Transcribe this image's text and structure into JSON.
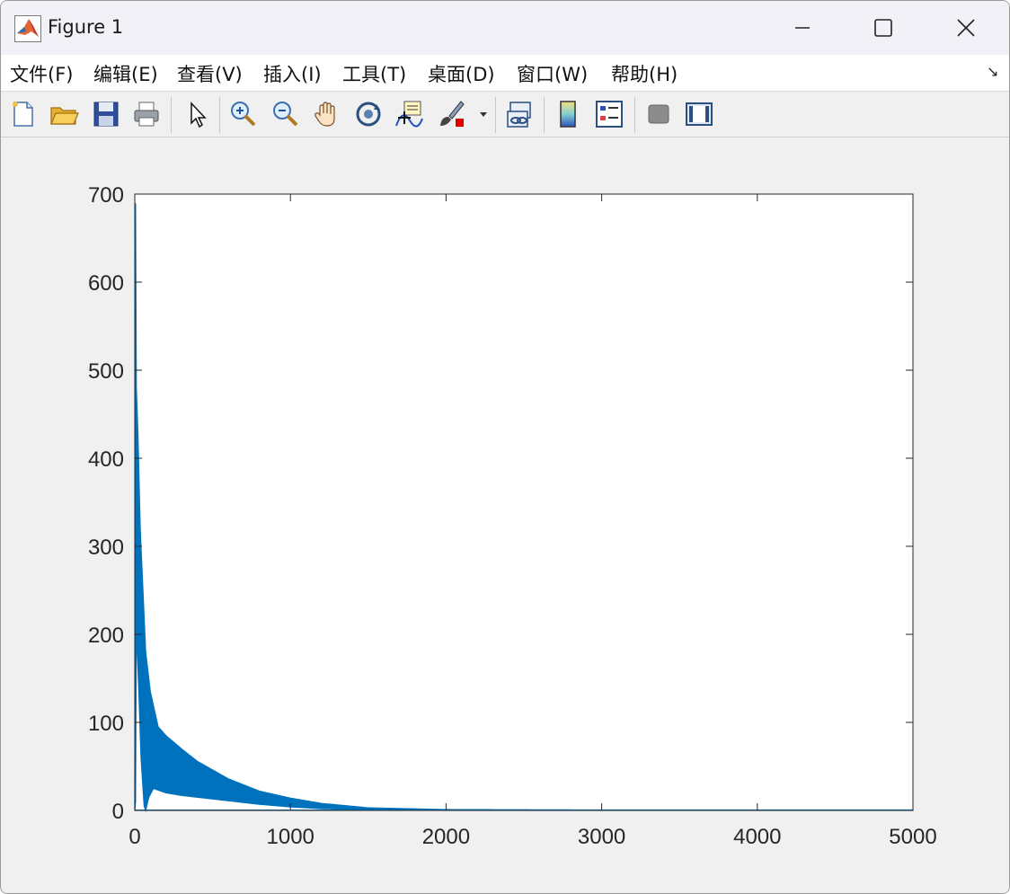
{
  "window": {
    "title": "Figure 1",
    "controls": {
      "minimize": "minimize",
      "maximize": "maximize",
      "close": "close"
    }
  },
  "menu": {
    "items": [
      {
        "label": "文件(F)"
      },
      {
        "label": "编辑(E)"
      },
      {
        "label": "查看(V)"
      },
      {
        "label": "插入(I)"
      },
      {
        "label": "工具(T)"
      },
      {
        "label": "桌面(D)"
      },
      {
        "label": "窗口(W)"
      },
      {
        "label": "帮助(H)"
      }
    ],
    "dock_icon": "↘"
  },
  "toolbar": {
    "icons": [
      "new-figure-icon",
      "open-folder-icon",
      "save-icon",
      "print-icon",
      "pointer-icon",
      "zoom-in-icon",
      "zoom-out-icon",
      "pan-hand-icon",
      "rotate-3d-icon",
      "data-cursor-icon",
      "brush-icon",
      "link-plot-icon",
      "colorbar-icon",
      "legend-icon",
      "hide-plot-tools-icon",
      "show-plot-tools-icon"
    ]
  },
  "chart_data": {
    "type": "line",
    "title": "",
    "xlabel": "",
    "ylabel": "",
    "xlim": [
      0,
      5000
    ],
    "ylim": [
      0,
      700
    ],
    "xticks": [
      "0",
      "1000",
      "2000",
      "3000",
      "4000",
      "5000"
    ],
    "yticks": [
      "0",
      "100",
      "200",
      "300",
      "400",
      "500",
      "600",
      "700"
    ],
    "grid": false,
    "series": [
      {
        "color": "#0072bd",
        "upper_envelope": {
          "x": [
            0,
            5,
            10,
            20,
            35,
            50,
            70,
            100,
            150,
            200,
            300,
            400,
            600,
            800,
            1000,
            1200,
            1500,
            2000,
            3000,
            5000
          ],
          "y": [
            0,
            690,
            480,
            430,
            320,
            260,
            180,
            135,
            95,
            85,
            70,
            56,
            36,
            22,
            14,
            8,
            3,
            1,
            0.5,
            0.5
          ]
        },
        "lower_envelope": {
          "x": [
            0,
            5,
            10,
            15,
            25,
            40,
            60,
            70,
            90,
            120,
            200,
            300,
            600,
            800,
            1000,
            1200,
            1500,
            2000,
            5000
          ],
          "y": [
            0,
            10,
            200,
            185,
            140,
            60,
            5,
            0,
            15,
            25,
            20,
            17,
            11,
            7,
            4,
            2,
            1,
            0.3,
            0.3
          ]
        }
      }
    ]
  }
}
